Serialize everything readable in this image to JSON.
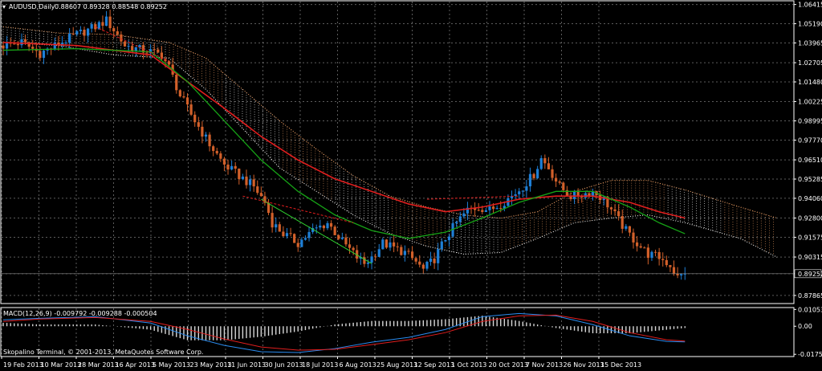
{
  "window": {
    "symbol_title": "AUDUSD,Daily",
    "ohlc": "0.88607 0.89328 0.88548 0.89252"
  },
  "macd": {
    "label": "MACD(12,26,9) -0.009792 -0.009288 -0.000504",
    "axis_ticks": [
      "0.01053",
      "0.00",
      "-0.01759"
    ]
  },
  "copyright": "Skopalino Terminal, © 2001-2013, MetaQuotes Software Corp.",
  "current_price": "0.89252",
  "colors": {
    "background": "#000000",
    "grid": "#9a9a9a",
    "bull_candle": "#1e7fd6",
    "bear_candle": "#d2602a",
    "ma_fast": "#16a316",
    "ma_slow": "#e01e1e",
    "cloud_bull": "#ffffff",
    "cloud_bear": "#f2a266",
    "macd_line": "#2a8cf0",
    "signal_line": "#e01e1e",
    "macd_hist": "#d8d8d8",
    "trend_line": "#2fd22f"
  },
  "chart_data": [
    {
      "type": "candlestick",
      "title": "AUDUSD,Daily",
      "y_ticks": [
        "1.06415",
        "1.05190",
        "1.03965",
        "1.02705",
        "1.01480",
        "1.00225",
        "0.98995",
        "0.97770",
        "0.96510",
        "0.95285",
        "0.94060",
        "0.92800",
        "0.91575",
        "0.90315",
        "0.89252",
        "0.87865"
      ],
      "ylim": [
        0.874,
        1.066
      ],
      "x_labels": [
        "19 Feb 2013",
        "10 Mar 2013",
        "28 Mar 2013",
        "16 Apr 2013",
        "5 May 2013",
        "23 May 2013",
        "11 Jun 2013",
        "30 Jun 2013",
        "18 Jul 2013",
        "6 Aug 2013",
        "25 Aug 2013",
        "12 Sep 2013",
        "1 Oct 2013",
        "20 Oct 2013",
        "7 Nov 2013",
        "26 Nov 2013",
        "15 Dec 2013"
      ],
      "grid": true,
      "price_path": [
        [
          0,
          1.038
        ],
        [
          5,
          1.04
        ],
        [
          10,
          1.033
        ],
        [
          15,
          1.039
        ],
        [
          20,
          1.045
        ],
        [
          25,
          1.05
        ],
        [
          28,
          1.054
        ],
        [
          30,
          1.048
        ],
        [
          33,
          1.038
        ],
        [
          36,
          1.036
        ],
        [
          40,
          1.034
        ],
        [
          43,
          1.032
        ],
        [
          45,
          1.024
        ],
        [
          48,
          1.006
        ],
        [
          52,
          0.99
        ],
        [
          56,
          0.975
        ],
        [
          60,
          0.962
        ],
        [
          64,
          0.955
        ],
        [
          68,
          0.948
        ],
        [
          71,
          0.938
        ],
        [
          73,
          0.925
        ],
        [
          76,
          0.918
        ],
        [
          80,
          0.912
        ],
        [
          84,
          0.92
        ],
        [
          88,
          0.925
        ],
        [
          92,
          0.913
        ],
        [
          96,
          0.903
        ],
        [
          98,
          0.899
        ],
        [
          100,
          0.903
        ],
        [
          103,
          0.912
        ],
        [
          106,
          0.909
        ],
        [
          109,
          0.906
        ],
        [
          112,
          0.9
        ],
        [
          114,
          0.895
        ],
        [
          117,
          0.902
        ],
        [
          120,
          0.915
        ],
        [
          123,
          0.925
        ],
        [
          126,
          0.933
        ],
        [
          129,
          0.935
        ],
        [
          132,
          0.933
        ],
        [
          135,
          0.937
        ],
        [
          138,
          0.942
        ],
        [
          141,
          0.948
        ],
        [
          144,
          0.956
        ],
        [
          146,
          0.966
        ],
        [
          148,
          0.96
        ],
        [
          151,
          0.948
        ],
        [
          154,
          0.942
        ],
        [
          157,
          0.943
        ],
        [
          160,
          0.945
        ],
        [
          163,
          0.94
        ],
        [
          166,
          0.93
        ],
        [
          169,
          0.92
        ],
        [
          172,
          0.912
        ],
        [
          175,
          0.905
        ],
        [
          178,
          0.903
        ],
        [
          181,
          0.898
        ],
        [
          183,
          0.89
        ],
        [
          185,
          0.8925
        ]
      ],
      "ma_slow": [
        [
          0,
          1.04
        ],
        [
          20,
          1.038
        ],
        [
          40,
          1.032
        ],
        [
          50,
          1.015
        ],
        [
          60,
          0.998
        ],
        [
          70,
          0.98
        ],
        [
          80,
          0.965
        ],
        [
          90,
          0.953
        ],
        [
          100,
          0.945
        ],
        [
          110,
          0.937
        ],
        [
          120,
          0.932
        ],
        [
          130,
          0.935
        ],
        [
          140,
          0.94
        ],
        [
          150,
          0.942
        ],
        [
          160,
          0.942
        ],
        [
          170,
          0.938
        ],
        [
          178,
          0.932
        ],
        [
          185,
          0.928
        ]
      ],
      "ma_fast": [
        [
          0,
          1.035
        ],
        [
          20,
          1.036
        ],
        [
          40,
          1.034
        ],
        [
          50,
          1.015
        ],
        [
          60,
          0.99
        ],
        [
          70,
          0.965
        ],
        [
          80,
          0.945
        ],
        [
          90,
          0.93
        ],
        [
          100,
          0.92
        ],
        [
          110,
          0.915
        ],
        [
          120,
          0.919
        ],
        [
          130,
          0.928
        ],
        [
          140,
          0.938
        ],
        [
          150,
          0.945
        ],
        [
          160,
          0.945
        ],
        [
          170,
          0.935
        ],
        [
          178,
          0.925
        ],
        [
          185,
          0.918
        ]
      ],
      "cloud_top": [
        [
          0,
          1.05
        ],
        [
          15,
          1.046
        ],
        [
          30,
          1.045
        ],
        [
          45,
          1.04
        ],
        [
          55,
          1.03
        ],
        [
          65,
          1.01
        ],
        [
          75,
          0.99
        ],
        [
          85,
          0.972
        ],
        [
          95,
          0.955
        ],
        [
          105,
          0.942
        ],
        [
          115,
          0.935
        ],
        [
          125,
          0.93
        ],
        [
          135,
          0.928
        ],
        [
          145,
          0.932
        ],
        [
          155,
          0.945
        ],
        [
          165,
          0.952
        ],
        [
          175,
          0.952
        ],
        [
          185,
          0.946
        ],
        [
          200,
          0.935
        ],
        [
          210,
          0.928
        ]
      ],
      "cloud_bottom": [
        [
          0,
          1.04
        ],
        [
          15,
          1.038
        ],
        [
          30,
          1.032
        ],
        [
          45,
          1.03
        ],
        [
          55,
          1.01
        ],
        [
          65,
          0.985
        ],
        [
          75,
          0.96
        ],
        [
          85,
          0.945
        ],
        [
          95,
          0.93
        ],
        [
          105,
          0.918
        ],
        [
          115,
          0.91
        ],
        [
          125,
          0.905
        ],
        [
          135,
          0.906
        ],
        [
          145,
          0.915
        ],
        [
          155,
          0.925
        ],
        [
          165,
          0.928
        ],
        [
          175,
          0.93
        ],
        [
          185,
          0.925
        ],
        [
          200,
          0.915
        ],
        [
          210,
          0.903
        ]
      ],
      "trend_line": [
        [
          70,
          0.94
        ],
        [
          100,
          0.899
        ]
      ],
      "dashed_lines": [
        [
          [
            25,
            1.05
          ],
          [
            45,
            1.028
          ]
        ],
        [
          [
            65,
            0.942
          ],
          [
            95,
            0.925
          ]
        ],
        [
          [
            115,
            0.94
          ],
          [
            140,
            0.942
          ]
        ]
      ]
    },
    {
      "type": "macd",
      "title": "MACD(12,26,9) -0.009792 -0.009288 -0.000504",
      "ylim": [
        -0.0185,
        0.0112
      ],
      "macd_path": [
        [
          0,
          0.004
        ],
        [
          10,
          0.005
        ],
        [
          25,
          0.006
        ],
        [
          40,
          0.002
        ],
        [
          50,
          -0.006
        ],
        [
          60,
          -0.012
        ],
        [
          70,
          -0.016
        ],
        [
          80,
          -0.0165
        ],
        [
          90,
          -0.014
        ],
        [
          100,
          -0.01
        ],
        [
          110,
          -0.007
        ],
        [
          120,
          -0.002
        ],
        [
          130,
          0.006
        ],
        [
          140,
          0.008
        ],
        [
          150,
          0.0065
        ],
        [
          160,
          0.001
        ],
        [
          170,
          -0.006
        ],
        [
          180,
          -0.0095
        ],
        [
          185,
          -0.0098
        ]
      ],
      "signal_path": [
        [
          0,
          0.003
        ],
        [
          10,
          0.0045
        ],
        [
          25,
          0.0055
        ],
        [
          40,
          0.003
        ],
        [
          50,
          -0.002
        ],
        [
          60,
          -0.008
        ],
        [
          70,
          -0.013
        ],
        [
          80,
          -0.015
        ],
        [
          90,
          -0.0145
        ],
        [
          100,
          -0.0115
        ],
        [
          110,
          -0.0085
        ],
        [
          120,
          -0.004
        ],
        [
          130,
          0.003
        ],
        [
          140,
          0.0065
        ],
        [
          150,
          0.007
        ],
        [
          160,
          0.003
        ],
        [
          170,
          -0.004
        ],
        [
          180,
          -0.0085
        ],
        [
          185,
          -0.0093
        ]
      ]
    }
  ]
}
